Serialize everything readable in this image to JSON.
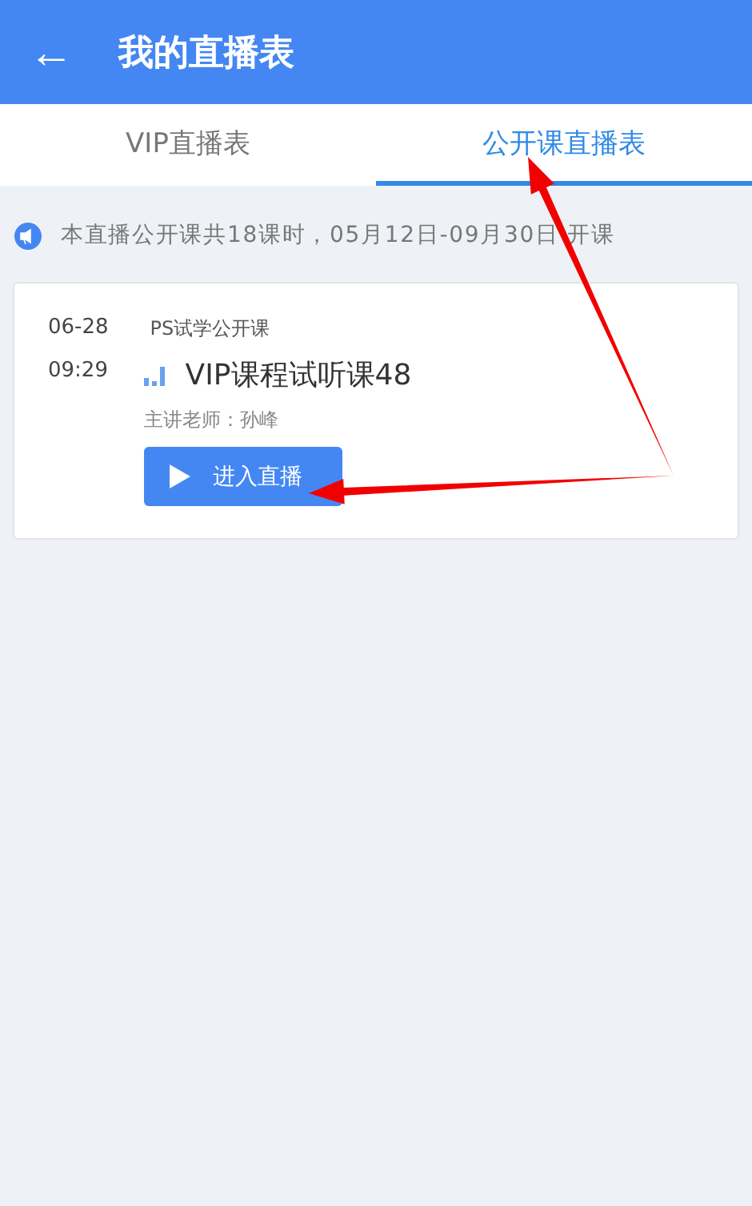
{
  "header": {
    "back": "←",
    "title": "我的直播表"
  },
  "tabs": [
    {
      "label": "VIP直播表",
      "selected": false
    },
    {
      "label": "公开课直播表",
      "selected": true
    }
  ],
  "notice": "本直播公开课共18课时，05月12日-09月30日 开课",
  "lessons": [
    {
      "date": "06-28",
      "time": "09:29",
      "category": "PS试学公开课",
      "title": "VIP课程试听课48",
      "teacher": "主讲老师：孙峰",
      "button": "进入直播"
    }
  ],
  "annotations": [
    {
      "kind": "arrow"
    },
    {
      "kind": "arrow"
    }
  ]
}
